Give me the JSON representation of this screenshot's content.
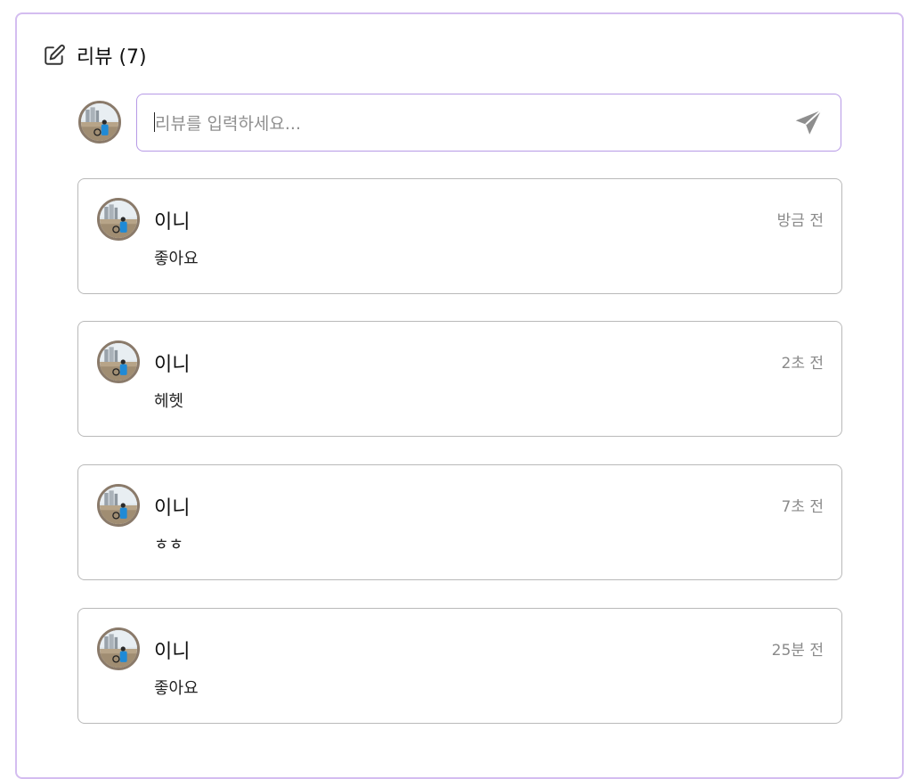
{
  "header": {
    "icon": "pencil-edit-icon",
    "title": "리뷰 (7)"
  },
  "composer": {
    "placeholder": "리뷰를 입력하세요...",
    "value": "",
    "send_icon": "send-icon"
  },
  "reviews": [
    {
      "author": "이니",
      "time": "방금 전",
      "content": "좋아요"
    },
    {
      "author": "이니",
      "time": "2초 전",
      "content": "헤헷"
    },
    {
      "author": "이니",
      "time": "7초 전",
      "content": "ㅎㅎ"
    },
    {
      "author": "이니",
      "time": "25분 전",
      "content": "좋아요"
    }
  ],
  "colors": {
    "card_border": "#d4bdf0",
    "input_border": "#b79ae6",
    "review_border": "#b9b9b9",
    "muted_text": "#8a8a8a"
  }
}
